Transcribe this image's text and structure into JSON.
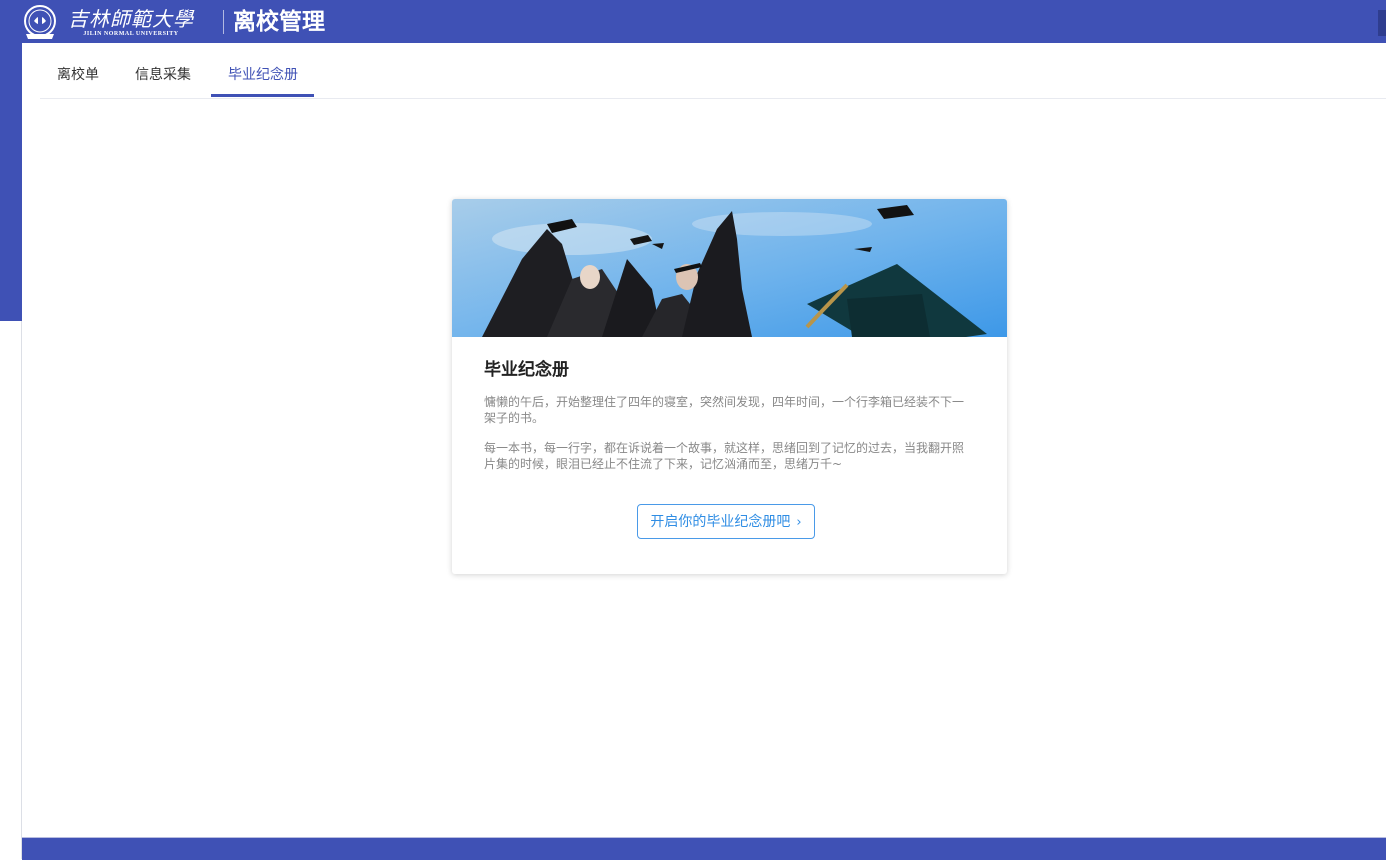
{
  "header": {
    "logo_cn": "吉林師範大學",
    "logo_en": "JILIN NORMAL UNIVERSITY",
    "app_title": "离校管理"
  },
  "tabs": [
    {
      "label": "离校单",
      "active": false
    },
    {
      "label": "信息采集",
      "active": false
    },
    {
      "label": "毕业纪念册",
      "active": true
    }
  ],
  "card": {
    "image": "graduation-caps-thrown-in-sky",
    "title": "毕业纪念册",
    "paragraph1": "慵懒的午后，开始整理住了四年的寝室，突然间发现，四年时间，一个行李箱已经装不下一架子的书。",
    "paragraph2": "每一本书，每一行字，都在诉说着一个故事，就这样，思绪回到了记忆的过去，当我翻开照片集的时候，眼泪已经止不住流了下来，记忆汹涌而至，思绪万千~",
    "cta_label": "开启你的毕业纪念册吧",
    "cta_icon": "chevron-right-icon"
  },
  "colors": {
    "primary": "#3f51b5",
    "cta": "#2f8de4",
    "text_muted": "#888888"
  }
}
